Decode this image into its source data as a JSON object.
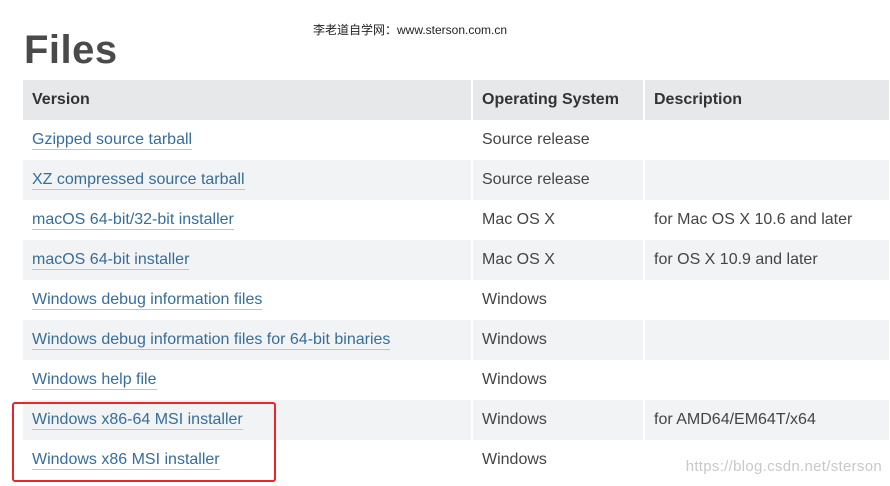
{
  "page": {
    "title": "Files"
  },
  "site_stamp": "李老道自学网：www.sterson.com.cn",
  "table": {
    "headers": [
      "Version",
      "Operating System",
      "Description"
    ],
    "rows": [
      {
        "version": "Gzipped source tarball",
        "os": "Source release",
        "description": ""
      },
      {
        "version": "XZ compressed source tarball",
        "os": "Source release",
        "description": ""
      },
      {
        "version": "macOS 64-bit/32-bit installer",
        "os": "Mac OS X",
        "description": "for Mac OS X 10.6 and later"
      },
      {
        "version": "macOS 64-bit installer",
        "os": "Mac OS X",
        "description": "for OS X 10.9 and later"
      },
      {
        "version": "Windows debug information files",
        "os": "Windows",
        "description": ""
      },
      {
        "version": "Windows debug information files for 64-bit binaries",
        "os": "Windows",
        "description": ""
      },
      {
        "version": "Windows help file",
        "os": "Windows",
        "description": ""
      },
      {
        "version": "Windows x86-64 MSI installer",
        "os": "Windows",
        "description": "for AMD64/EM64T/x64"
      },
      {
        "version": "Windows x86 MSI installer",
        "os": "Windows",
        "description": ""
      }
    ]
  },
  "watermark": "https://blog.csdn.net/sterson",
  "colors": {
    "link": "#366d9c",
    "link_underline": "#f5c542",
    "header_bg": "#e6e8ea",
    "stripe_bg": "#f2f3f4",
    "highlight": "#e8262a"
  }
}
